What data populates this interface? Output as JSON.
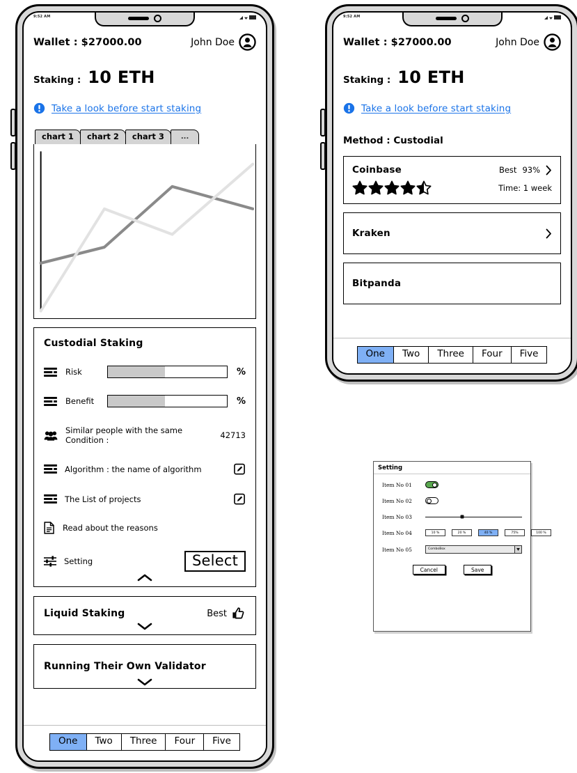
{
  "statusbar": {
    "time": "9:52 AM"
  },
  "header": {
    "wallet_label": "Wallet :",
    "wallet_amount": "$27000.00",
    "user_name": "John Doe",
    "avatar_icon": "user-circle-icon"
  },
  "staking": {
    "label": "Staking :",
    "value": "10 ETH"
  },
  "notice": {
    "icon": "info-exclamation-icon",
    "link_text": "Take a look before start staking"
  },
  "chart_tabs": {
    "items": [
      {
        "label": "chart 1"
      },
      {
        "label": "chart 2"
      },
      {
        "label": "chart 3"
      },
      {
        "label": "..."
      }
    ],
    "active_index": 0
  },
  "chart_data": {
    "type": "line",
    "title": "",
    "xlabel": "",
    "ylabel": "",
    "grid": false,
    "legend": "none",
    "xlim": [
      0,
      100
    ],
    "ylim": [
      0,
      100
    ],
    "x": [
      0,
      30,
      62,
      100
    ],
    "series": [
      {
        "name": "series-dark",
        "color": "#8a8a8a",
        "values": [
          30,
          40,
          78,
          64
        ]
      },
      {
        "name": "series-light",
        "color": "#e2e2e2",
        "values": [
          0,
          64,
          48,
          92
        ]
      }
    ]
  },
  "custodial_card": {
    "title": "Custodial Staking",
    "meters": [
      {
        "icon": "bars-icon",
        "label": "Risk",
        "value": 48,
        "suffix": "%"
      },
      {
        "icon": "bars-icon",
        "label": "Benefit",
        "value": 48,
        "suffix": "%"
      }
    ],
    "similar": {
      "icon": "people-icon",
      "label": "Similar people with the same Condition :",
      "value": "42713"
    },
    "rows": [
      {
        "icon": "bars-icon",
        "label": "Algorithm : the name of algorithm",
        "action_icon": "edit-icon"
      },
      {
        "icon": "bars-icon",
        "label": "The List of projects",
        "action_icon": "edit-icon"
      },
      {
        "icon": "document-icon",
        "label": "Read about the reasons",
        "action_icon": ""
      },
      {
        "icon": "sliders-icon",
        "label": "Setting",
        "action_icon": ""
      }
    ],
    "select_button": "Select",
    "collapse_icon": "chevron-up-icon"
  },
  "other_cards": [
    {
      "title": "Liquid Staking",
      "badge": "Best",
      "badge_icon": "thumbs-up-icon",
      "expand_icon": "chevron-down-icon"
    },
    {
      "title": "Running Their Own Validator",
      "badge": "",
      "badge_icon": "",
      "expand_icon": "chevron-down-icon"
    }
  ],
  "bottom_nav": {
    "items": [
      "One",
      "Two",
      "Three",
      "Four",
      "Five"
    ],
    "active_index": 0
  },
  "method": {
    "label": "Method : Custodial",
    "providers": [
      {
        "name": "Coinbase",
        "best_label": "Best",
        "best_value": "93%",
        "chevron_icon": "chevron-right-icon",
        "rating": 4.5,
        "time_label": "Time: 1 week",
        "expanded": true
      },
      {
        "name": "Kraken",
        "best_label": "",
        "best_value": "",
        "chevron_icon": "chevron-right-icon",
        "rating": 0,
        "time_label": "",
        "expanded": false
      },
      {
        "name": "Bitpanda",
        "best_label": "",
        "best_value": "",
        "chevron_icon": "",
        "rating": 0,
        "time_label": "",
        "expanded": false
      }
    ]
  },
  "setting_dialog": {
    "title": "Setting",
    "rows": [
      {
        "label": "Item No 01",
        "control": "toggle",
        "state": "on"
      },
      {
        "label": "Item No 02",
        "control": "toggle",
        "state": "off"
      },
      {
        "label": "Item No 03",
        "control": "slider",
        "value": 38
      },
      {
        "label": "Item No 04",
        "control": "percent-buttons"
      },
      {
        "label": "Item No 05",
        "control": "combobox",
        "value": "ComboBox"
      }
    ],
    "percent_options": [
      "10 %",
      "20 %",
      "40 %",
      "75%",
      "100 %"
    ],
    "percent_active_index": 2,
    "combo_dropdown_icon": "caret-down-icon",
    "cancel_button": "Cancel",
    "save_button": "Save"
  },
  "colors": {
    "accent_blue": "#1a73e8",
    "select_blue": "#7fb0f5",
    "toggle_green": "#5aa84f",
    "meter_fill": "#c9c9c9",
    "line_dark": "#8a8a8a",
    "line_light": "#e2e2e2"
  }
}
